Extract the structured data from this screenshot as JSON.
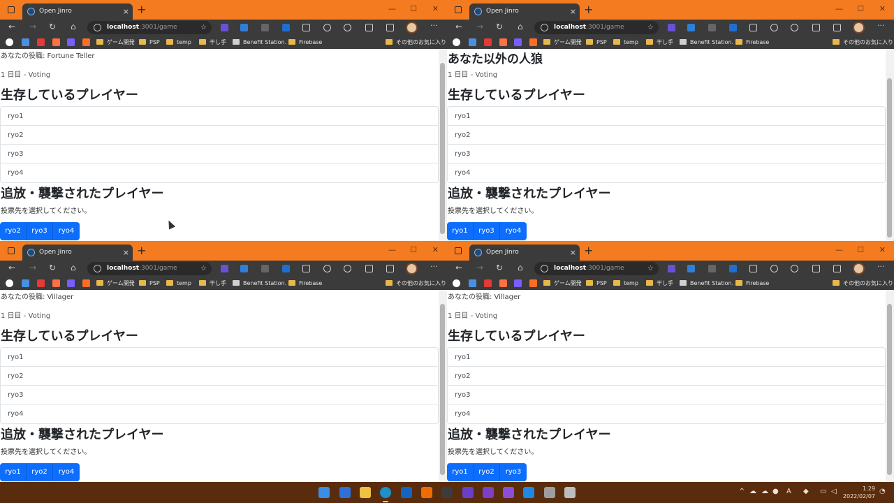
{
  "browser": {
    "tab_title": "Open Jinro",
    "url_host": "localhost",
    "url_rest": ":3001/game",
    "new_tab": "+",
    "close_tab": "×",
    "minimize": "—",
    "maximize": "☐",
    "close_window": "✕",
    "back": "←",
    "forward": "→",
    "reload": "↻",
    "home": "⌂",
    "menu": "···",
    "bookmarks": {
      "game_dev": "ゲーム開発",
      "psp": "PSP",
      "temp": "temp",
      "hoshite": "干し手",
      "benefit": "Benefit Station.",
      "firebase": "Firebase",
      "other": "その他のお気に入り"
    }
  },
  "windows": [
    {
      "role_line": "あなたの役職: Fortune Teller",
      "day_line": "1 日目 - Voting",
      "alive_heading": "生存しているプレイヤー",
      "alive_players": [
        "ryo1",
        "ryo2",
        "ryo3",
        "ryo4"
      ],
      "exiled_heading": "追放・襲撃されたプレイヤー",
      "instruction": "投票先を選択してください。",
      "vote_buttons": [
        "ryo2",
        "ryo3",
        "ryo4"
      ]
    },
    {
      "top_heading": "あなた以外の人狼",
      "day_line": "1 日目 - Voting",
      "alive_heading": "生存しているプレイヤー",
      "alive_players": [
        "ryo1",
        "ryo2",
        "ryo3",
        "ryo4"
      ],
      "exiled_heading": "追放・襲撃されたプレイヤー",
      "instruction": "投票先を選択してください。",
      "vote_buttons": [
        "ryo1",
        "ryo3",
        "ryo4"
      ]
    },
    {
      "role_line": "あなたの役職: Villager",
      "day_line": "1 日目 - Voting",
      "alive_heading": "生存しているプレイヤー",
      "alive_players": [
        "ryo1",
        "ryo2",
        "ryo3",
        "ryo4"
      ],
      "exiled_heading": "追放・襲撃されたプレイヤー",
      "instruction": "投票先を選択してください。",
      "vote_buttons": [
        "ryo1",
        "ryo2",
        "ryo4"
      ]
    },
    {
      "role_line": "あなたの役職: Villager",
      "day_line": "1 日目 - Voting",
      "alive_heading": "生存しているプレイヤー",
      "alive_players": [
        "ryo1",
        "ryo2",
        "ryo3",
        "ryo4"
      ],
      "exiled_heading": "追放・襲撃されたプレイヤー",
      "instruction": "投票先を選択してください。",
      "vote_buttons": [
        "ryo1",
        "ryo2",
        "ryo3"
      ]
    }
  ],
  "taskbar": {
    "time": "1:29",
    "date": "2022/02/07",
    "ime": "A"
  },
  "colors": {
    "title_bar": "#f47b20",
    "browser_chrome": "#3b3b3b",
    "vote_button": "#0d6efd",
    "taskbar": "#5a2c0e"
  }
}
